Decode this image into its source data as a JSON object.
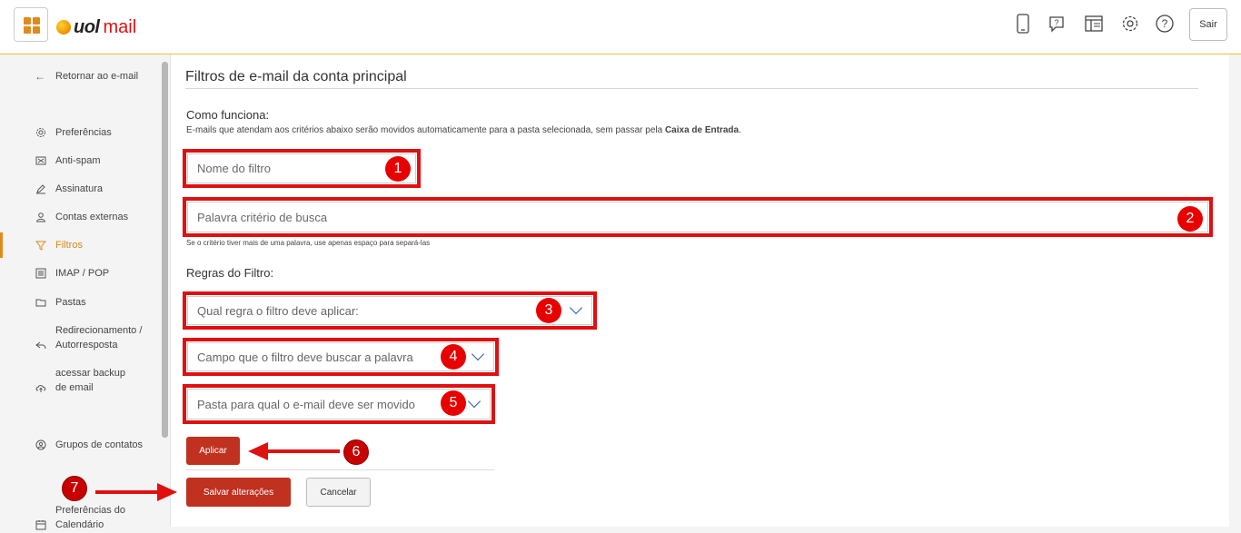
{
  "header": {
    "brand_uol": "uol",
    "brand_mail": "mail",
    "icons": [
      "mobile-icon",
      "help-chat-icon",
      "layout-icon",
      "gear-icon",
      "help-icon"
    ],
    "logout_label": "Sair"
  },
  "sidebar": {
    "back_label": "Retornar ao e-mail",
    "items": [
      {
        "label": "Preferências",
        "icon": "gear-icon"
      },
      {
        "label": "Anti-spam",
        "icon": "spam-icon"
      },
      {
        "label": "Assinatura",
        "icon": "pen-icon"
      },
      {
        "label": "Contas externas",
        "icon": "user-icon"
      },
      {
        "label": "Filtros",
        "icon": "filter-icon",
        "active": true
      },
      {
        "label": "IMAP / POP",
        "icon": "list-icon"
      },
      {
        "label": "Pastas",
        "icon": "folder-icon"
      },
      {
        "label": "Redirecionamento / Autorresposta",
        "line1": "Redirecionamento /",
        "line2": "Autorresposta",
        "icon": "reply-icon"
      },
      {
        "label": "acessar backup de email",
        "line1": "acessar backup",
        "line2": "de email",
        "icon": "cloud-icon"
      },
      {
        "label": "Grupos de contatos",
        "icon": "group-icon"
      },
      {
        "label": "Preferências do Calendário",
        "line1": "Preferências do",
        "line2": "Calendário",
        "icon": "calendar-icon"
      }
    ]
  },
  "main": {
    "title": "Filtros de e-mail da conta principal",
    "how_title": "Como funciona:",
    "how_text_pre": "E-mails que atendam aos critérios abaixo serão movidos automaticamente para a pasta selecionada, sem passar pela ",
    "how_text_bold": "Caixa de Entrada",
    "how_text_post": ".",
    "filter_name_placeholder": "Nome do filtro",
    "keyword_placeholder": "Palavra critério de busca",
    "keyword_hint": "Se o critério tiver mais de uma palavra, use apenas espaço para separá-las",
    "rules_title": "Regras do Filtro:",
    "rule_select": "Qual regra o filtro deve aplicar:",
    "field_select": "Campo que o filtro deve buscar a palavra",
    "folder_select": "Pasta para qual o e-mail deve ser movido",
    "apply_label": "Aplicar",
    "save_label": "Salvar alterações",
    "cancel_label": "Cancelar"
  },
  "annotations": {
    "highlight_color": "#e01010",
    "badges": [
      "1",
      "2",
      "3",
      "4",
      "5",
      "6",
      "7"
    ]
  }
}
